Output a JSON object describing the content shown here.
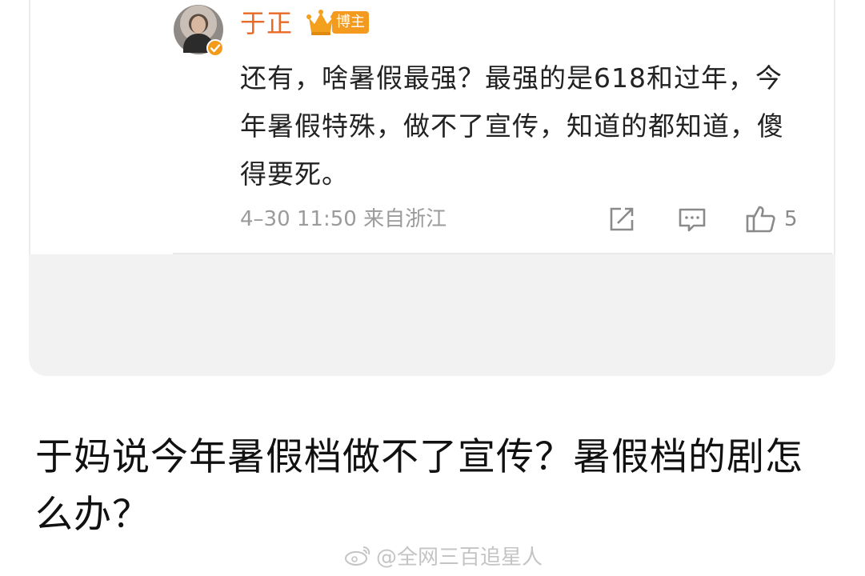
{
  "comment": {
    "username": "于正",
    "badge_label": "博主",
    "text": "还有，啥暑假最强？最强的是618和过年，今年暑假特殊，做不了宣传，知道的都知道，傻得要死。",
    "meta": "4–30 11:50  来自浙江",
    "like_count": "5",
    "icons": {
      "share": "share-icon",
      "comment": "comment-icon",
      "like": "thumbs-up-icon",
      "verified": "verified-badge-icon",
      "crown": "crown-icon"
    }
  },
  "headline": "于妈说今年暑假档做不了宣传？暑假档的剧怎么办？",
  "watermark": "@全网三百追星人",
  "colors": {
    "username": "#e86a27",
    "badge": "#f39a1f",
    "meta": "#9b9b9b",
    "card_bg": "#f2f2f2"
  }
}
